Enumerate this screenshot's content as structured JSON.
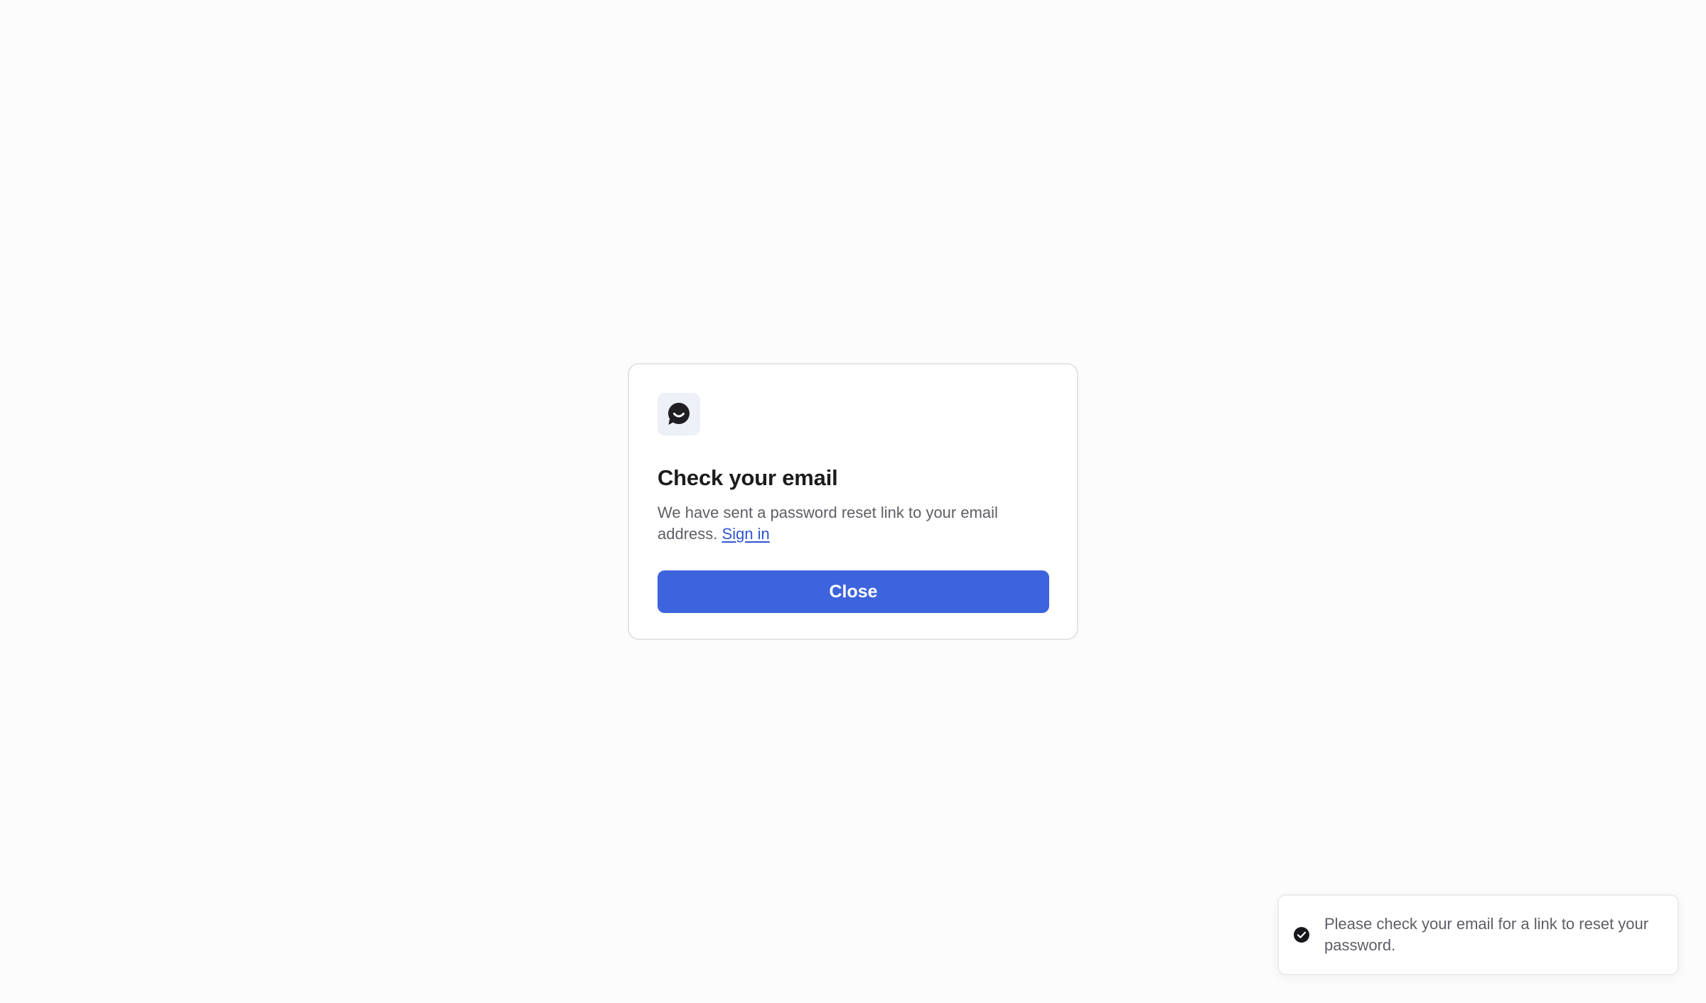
{
  "card": {
    "logo_icon": "chat-bubble-smile-icon",
    "title": "Check your email",
    "description": "We have sent a password reset link to your email address.",
    "sign_in_link": "Sign in",
    "close_button": "Close"
  },
  "toast": {
    "icon": "check-circle-icon",
    "message": "Please check your email for a link to reset your password."
  },
  "colors": {
    "primary": "#3d64dd",
    "link": "#2f55d4",
    "background": "#fcfcfc",
    "text_dark": "#1c1c1e",
    "text_muted": "#5e5e66"
  }
}
